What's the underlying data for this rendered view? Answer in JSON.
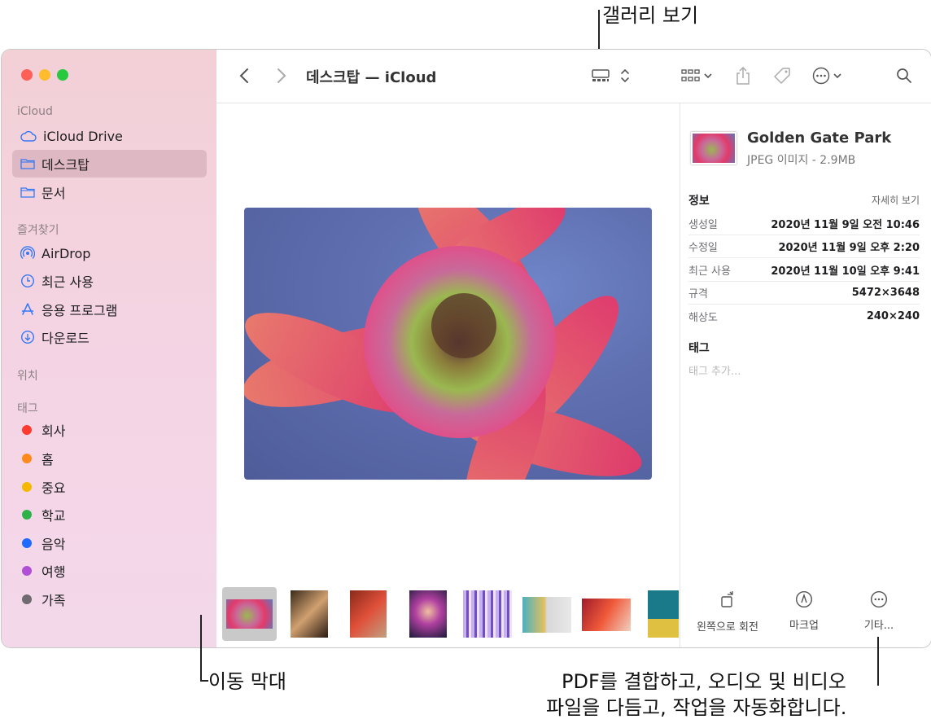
{
  "callouts": {
    "gallery_view": "갤러리 보기",
    "scrubber": "이동 막대",
    "more_line1": "PDF를 결합하고, 오디오 및 비디오",
    "more_line2": "파일을 다듬고, 작업을 자동화합니다."
  },
  "window": {
    "title": "데스크탑 — iCloud"
  },
  "sidebar": {
    "sections": {
      "icloud": "iCloud",
      "favorites": "즐겨찾기",
      "locations": "위치",
      "tags": "태그"
    },
    "icloud_items": [
      {
        "label": "iCloud Drive",
        "icon": "cloud-icon"
      },
      {
        "label": "데스크탑",
        "icon": "folder-icon",
        "selected": true
      },
      {
        "label": "문서",
        "icon": "folder-icon"
      }
    ],
    "favorite_items": [
      {
        "label": "AirDrop",
        "icon": "airdrop-icon"
      },
      {
        "label": "최근 사용",
        "icon": "clock-icon"
      },
      {
        "label": "응용 프로그램",
        "icon": "apps-icon"
      },
      {
        "label": "다운로드",
        "icon": "download-icon"
      }
    ],
    "tag_items": [
      {
        "label": "회사",
        "color": "#ff3b30"
      },
      {
        "label": "홈",
        "color": "#ff8a1c"
      },
      {
        "label": "중요",
        "color": "#f5b800"
      },
      {
        "label": "학교",
        "color": "#2fb14a"
      },
      {
        "label": "음악",
        "color": "#1f6bff"
      },
      {
        "label": "여행",
        "color": "#b04fd6"
      },
      {
        "label": "가족",
        "color": "#6e6a70"
      }
    ]
  },
  "inspector": {
    "file_name": "Golden Gate Park",
    "file_type": "JPEG 이미지 - 2.9MB",
    "info_label": "정보",
    "show_more": "자세히 보기",
    "rows": [
      {
        "key": "생성일",
        "value": "2020년 11월 9일 오전 10:46"
      },
      {
        "key": "수정일",
        "value": "2020년 11월 9일 오후 2:20"
      },
      {
        "key": "최근 사용",
        "value": "2020년 11월 10일 오후 9:41"
      },
      {
        "key": "규격",
        "value": "5472×3648"
      },
      {
        "key": "해상도",
        "value": "240×240"
      }
    ],
    "tags_label": "태그",
    "add_tag": "태그 추가...",
    "actions": {
      "rotate": "왼쪽으로 회전",
      "markup": "마크업",
      "more": "기타..."
    }
  },
  "colors": {
    "close": "#fe5f57",
    "minimize": "#febc2e",
    "zoom": "#28c840",
    "selection": "#c8a4ad"
  }
}
